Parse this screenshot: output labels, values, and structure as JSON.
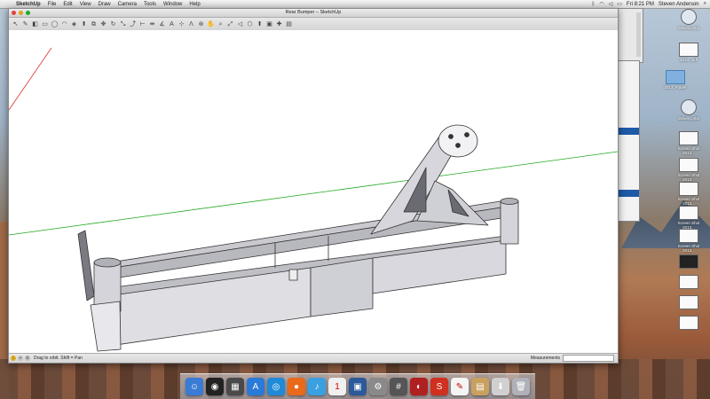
{
  "menubar": {
    "app_name": "SketchUp",
    "items": [
      "File",
      "Edit",
      "View",
      "Draw",
      "Camera",
      "Tools",
      "Window",
      "Help"
    ],
    "clock": "Fri 8:21 PM",
    "user": "Steven Anderson"
  },
  "window": {
    "title": "Rear Bumper – SketchUp",
    "toolbar_icons": [
      "select-icon",
      "pencil-icon",
      "eraser-icon",
      "rectangle-icon",
      "circle-icon",
      "arc-icon",
      "paint-bucket-icon",
      "push-pull-icon",
      "offset-icon",
      "move-icon",
      "rotate-icon",
      "scale-icon",
      "follow-me-icon",
      "tape-measure-icon",
      "dimension-icon",
      "protractor-icon",
      "text-icon",
      "axes-icon",
      "3d-text-icon",
      "orbit-icon",
      "pan-icon",
      "zoom-icon",
      "zoom-extents-icon",
      "previous-view-icon",
      "warehouse-icon",
      "share-model-icon",
      "components-icon",
      "extension-icon",
      "layout-icon"
    ],
    "status_hint": "Drag to orbit.  Shift = Pan",
    "measurements_label": "Measurements",
    "measurements_value": ""
  },
  "desktop_icons": [
    {
      "label": "drawing.skp",
      "kind": "round"
    },
    {
      "label": "2013...pdf",
      "kind": "doc"
    },
    {
      "label": "2013_Folder",
      "kind": "folder"
    },
    {
      "label": "drawing.skb",
      "kind": "round"
    },
    {
      "label": "Screen Shot 2013...",
      "kind": "doc"
    },
    {
      "label": "Screen Shot 2013...",
      "kind": "doc"
    },
    {
      "label": "Screen Shot 2013...",
      "kind": "doc"
    },
    {
      "label": "Screen Shot 2013...",
      "kind": "doc"
    },
    {
      "label": "Screen Shot 2013...",
      "kind": "doc"
    },
    {
      "label": "",
      "kind": "dark"
    },
    {
      "label": "",
      "kind": "doc"
    },
    {
      "label": "",
      "kind": "doc"
    },
    {
      "label": "",
      "kind": "doc"
    }
  ],
  "dock": [
    {
      "name": "finder",
      "color": "#3a7bd5",
      "glyph": "☺"
    },
    {
      "name": "dashboard",
      "color": "#222222",
      "glyph": "◉"
    },
    {
      "name": "mission-control",
      "color": "#4a4a4a",
      "glyph": "▦"
    },
    {
      "name": "app-store",
      "color": "#2a7ad8",
      "glyph": "A"
    },
    {
      "name": "safari",
      "color": "#1f8ad8",
      "glyph": "◎"
    },
    {
      "name": "firefox",
      "color": "#e86a1a",
      "glyph": "●"
    },
    {
      "name": "itunes",
      "color": "#3aa0e0",
      "glyph": "♪"
    },
    {
      "name": "calendar",
      "color": "#f0f0f0",
      "glyph": "1"
    },
    {
      "name": "preview",
      "color": "#2a5a9a",
      "glyph": "▣"
    },
    {
      "name": "system-preferences",
      "color": "#8a8a8a",
      "glyph": "⚙"
    },
    {
      "name": "calculator",
      "color": "#555555",
      "glyph": "#"
    },
    {
      "name": "photo-booth",
      "color": "#b02020",
      "glyph": "◐"
    },
    {
      "name": "sketchup",
      "color": "#d03020",
      "glyph": "S"
    },
    {
      "name": "textedit",
      "color": "#f4f4f4",
      "glyph": "✎"
    },
    {
      "name": "documents",
      "color": "#c8a060",
      "glyph": "▤"
    },
    {
      "name": "downloads",
      "color": "#d0d0d0",
      "glyph": "⬇"
    },
    {
      "name": "trash",
      "color": "#b0b0b8",
      "glyph": "🗑"
    }
  ]
}
